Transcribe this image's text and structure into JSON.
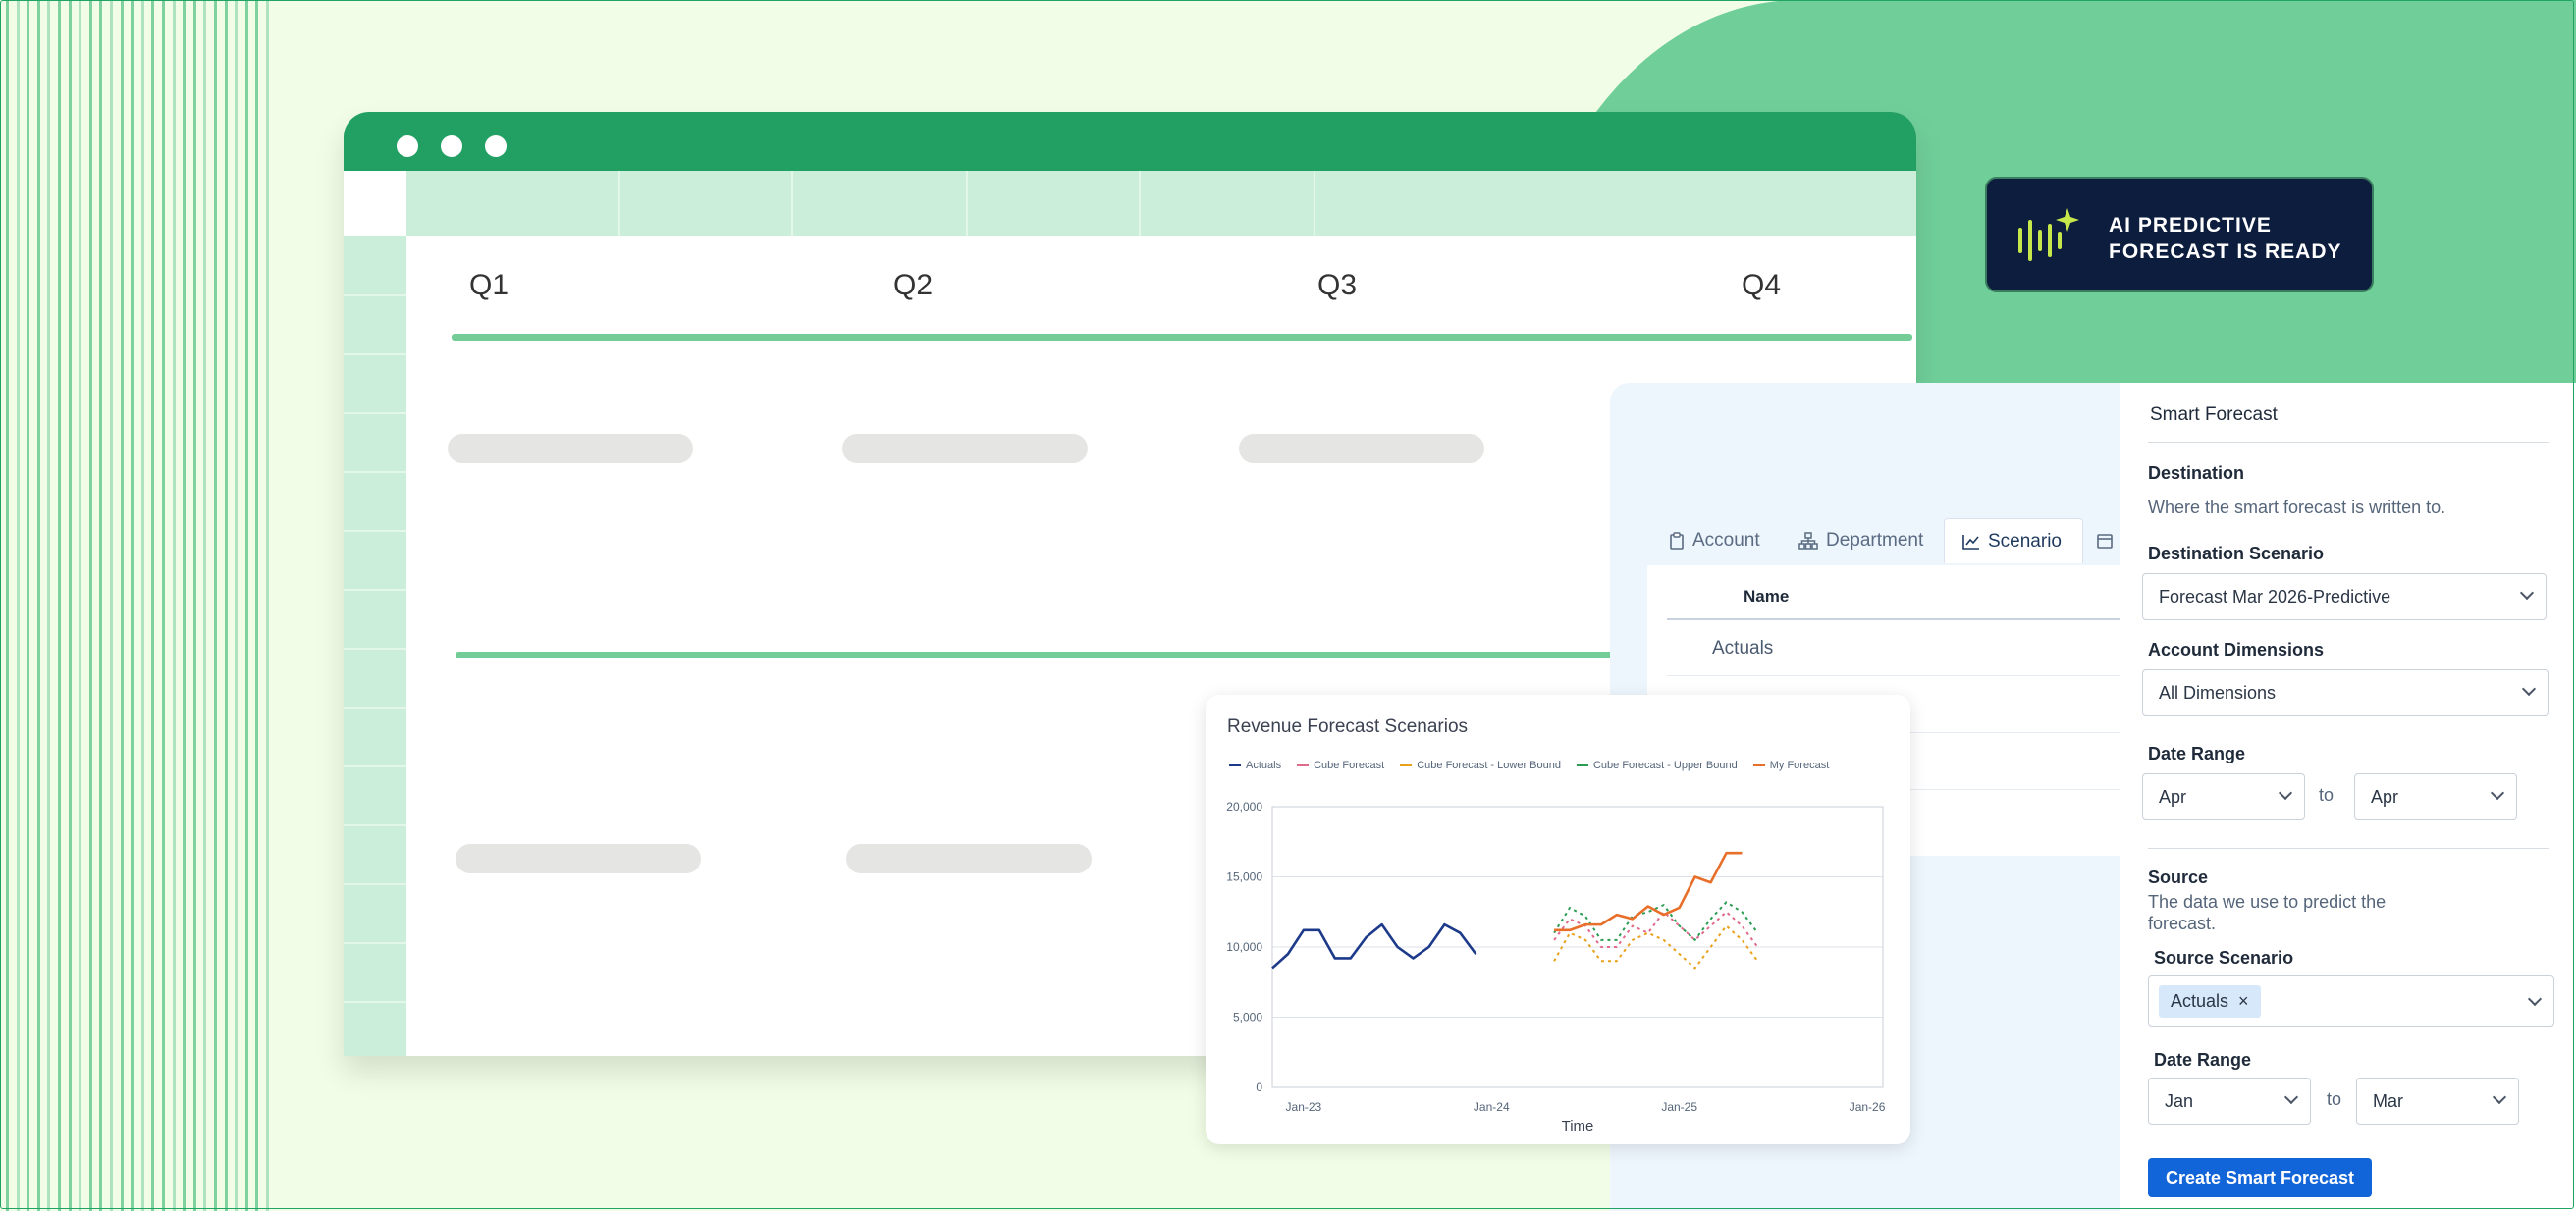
{
  "window": {
    "quarters": [
      "Q1",
      "Q2",
      "Q3",
      "Q4"
    ]
  },
  "badge": {
    "line1": "AI PREDICTIVE",
    "line2": "FORECAST IS READY",
    "icon": "sparkle-waveform-icon",
    "accent": "#c6e84a"
  },
  "tabs": [
    {
      "label": "Account",
      "icon": "clipboard-icon"
    },
    {
      "label": "Department",
      "icon": "org-chart-icon"
    },
    {
      "label": "Scenario",
      "icon": "line-chart-icon",
      "active": true
    },
    {
      "label": "",
      "icon": "calendar-icon"
    }
  ],
  "table": {
    "header": "Name",
    "rows": [
      "Actuals"
    ]
  },
  "smart_forecast": {
    "title": "Smart Forecast",
    "destination_label": "Destination",
    "destination_desc": "Where the smart forecast is written to.",
    "destination_scenario_label": "Destination Scenario",
    "destination_scenario_value": "Forecast Mar 2026-Predictive",
    "account_dimensions_label": "Account Dimensions",
    "account_dimensions_value": "All Dimensions",
    "date_range_label": "Date Range",
    "date_from": "Apr",
    "date_to": "Apr",
    "to_label": "to",
    "source_label": "Source",
    "source_desc_1": "The data we use to predict the",
    "source_desc_2": "forecast.",
    "source_scenario_label": "Source Scenario",
    "source_chip": "Actuals",
    "source_chip_remove": "×",
    "source_date_range_label": "Date Range",
    "source_date_from": "Jan",
    "source_date_to": "Mar",
    "button": "Create Smart Forecast",
    "button_color": "#1264d9"
  },
  "chart_data": {
    "type": "line",
    "title": "Revenue Forecast Scenarios",
    "xlabel": "Time",
    "ylabel": "",
    "ylim": [
      0,
      20000
    ],
    "yticks": [
      0,
      5000,
      10000,
      15000,
      20000
    ],
    "ytick_labels": [
      "0",
      "5,000",
      "10,000",
      "15,000",
      "20,000"
    ],
    "xtick_labels": [
      "Jan-23",
      "Jan-24",
      "Jan-25",
      "Jan-26"
    ],
    "xtick_positions": [
      0,
      12,
      24,
      36
    ],
    "legend_position": "top",
    "grid": true,
    "series": [
      {
        "name": "Actuals",
        "color": "#1d3a8a",
        "dash": false,
        "start": -2,
        "values": [
          8500,
          9500,
          11200,
          11200,
          9200,
          9200,
          10700,
          11600,
          10000,
          9200,
          10000,
          11600,
          11000,
          9500
        ]
      },
      {
        "name": "Cube Forecast",
        "color": "#e06a8a",
        "dash": true,
        "start": 16,
        "values": [
          10500,
          12000,
          11500,
          10000,
          10000,
          11500,
          11000,
          12500,
          11500,
          10500,
          11500,
          12500,
          11500,
          10000
        ]
      },
      {
        "name": "Cube Forecast - Lower Bound",
        "color": "#e8a11a",
        "dash": true,
        "start": 16,
        "values": [
          9000,
          11000,
          10500,
          9000,
          9000,
          10500,
          11000,
          10500,
          9500,
          8500,
          10000,
          11500,
          10500,
          9000
        ]
      },
      {
        "name": "Cube Forecast - Upper Bound",
        "color": "#2a9d52",
        "dash": true,
        "start": 16,
        "values": [
          11000,
          12800,
          12200,
          10500,
          10500,
          12200,
          12500,
          13000,
          11500,
          10500,
          12000,
          13200,
          12500,
          11000
        ]
      },
      {
        "name": "My Forecast",
        "color": "#e86f2a",
        "dash": false,
        "start": 16,
        "values": [
          11200,
          11200,
          11600,
          11600,
          12300,
          12000,
          12900,
          12300,
          12800,
          15000,
          14600,
          16700,
          16700
        ]
      }
    ]
  }
}
